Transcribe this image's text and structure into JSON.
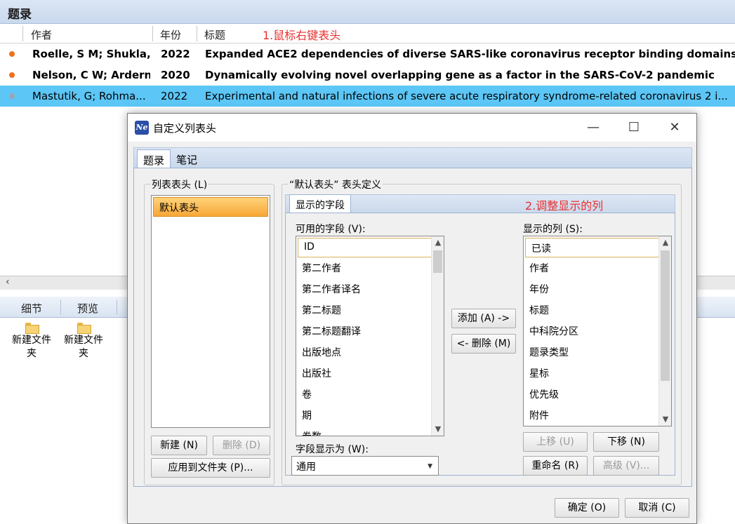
{
  "main_window": {
    "title": "题录",
    "columns": [
      "作者",
      "年份",
      "标题"
    ],
    "annotation_1": "1.鼠标右键表头",
    "rows": [
      {
        "author": "Roelle, S M; Shukla,",
        "year": "2022",
        "title": "Expanded ACE2 dependencies of diverse SARS-like coronavirus receptor binding domains"
      },
      {
        "author": "Nelson, C W; Ardern",
        "year": "2020",
        "title": "Dynamically evolving novel overlapping gene as a factor in the SARS-CoV-2 pandemic"
      },
      {
        "author": "Mastutik, G; Rohma...",
        "year": "2022",
        "title": "Experimental and natural infections of severe acute respiratory syndrome-related  coronavirus 2 i..."
      }
    ],
    "scroll_left": "‹",
    "lower_tabs": [
      "细节",
      "预览"
    ],
    "folders": [
      {
        "label": "新建文件夹"
      },
      {
        "label": "新建文件夹"
      }
    ]
  },
  "dialog": {
    "title": "自定义列表头",
    "app_icon_text": "Ne",
    "window_controls": {
      "minimize": "—",
      "maximize": "☐",
      "close": "✕"
    },
    "tabs": [
      "题录",
      "笔记"
    ],
    "list_group": {
      "legend": "列表表头 (L)",
      "items": [
        "默认表头"
      ],
      "new_button": "新建 (N)",
      "delete_button": "删除 (D)",
      "apply_button": "应用到文件夹 (P)..."
    },
    "def_group": {
      "legend": "“默认表头” 表头定义",
      "inner_tab": "显示的字段",
      "annotation_2": "2.调整显示的列",
      "available_label": "可用的字段 (V):",
      "available_fields": [
        "ID",
        "第二作者",
        "第二作者译名",
        "第二标题",
        "第二标题翻译",
        "出版地点",
        "出版社",
        "卷",
        "期",
        "卷数"
      ],
      "displayed_label": "显示的列 (S):",
      "displayed_columns": [
        "已读",
        "作者",
        "年份",
        "标题",
        "中科院分区",
        "题录类型",
        "星标",
        "优先级",
        "附件"
      ],
      "add_button": "添加 (A) ->",
      "remove_button": "<- 删除 (M)",
      "display_as_label": "字段显示为 (W):",
      "display_as_value": "通用",
      "move_up_button": "上移 (U)",
      "move_down_button": "下移 (N)",
      "rename_button": "重命名 (R)",
      "advanced_button": "高级 (V)..."
    },
    "ok_button": "确定 (O)",
    "cancel_button": "取消 (C)"
  }
}
